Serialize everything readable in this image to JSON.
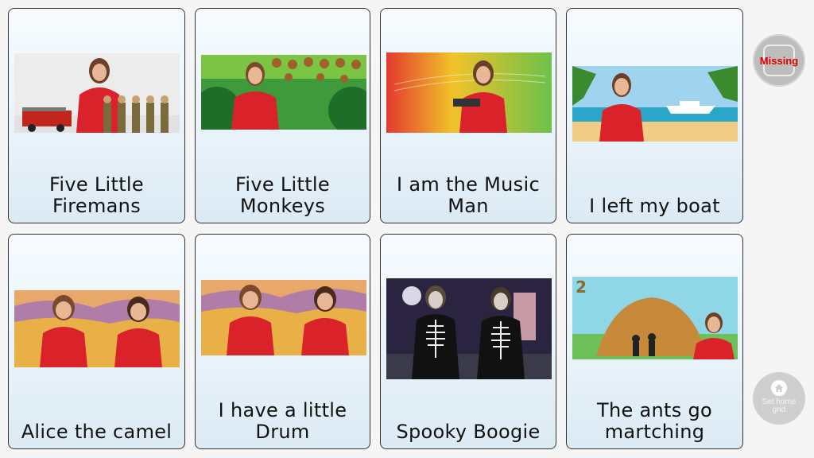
{
  "tiles": [
    {
      "label": "Five Little Firemans",
      "image": "fireman-video-thumbnail"
    },
    {
      "label": "Five Little Monkeys",
      "image": "monkeys-jungle-video-thumbnail"
    },
    {
      "label": "I am the Music Man",
      "image": "music-man-video-thumbnail"
    },
    {
      "label": "I left my boat",
      "image": "beach-boat-video-thumbnail"
    },
    {
      "label": "Alice the camel",
      "image": "desert-duo-video-thumbnail"
    },
    {
      "label": "I have a little Drum",
      "image": "desert-duo-video-thumbnail"
    },
    {
      "label": "Spooky Boogie",
      "image": "skeleton-costume-video-thumbnail"
    },
    {
      "label": "The ants go martching",
      "image": "anthill-video-thumbnail"
    }
  ],
  "sidebar": {
    "missing_label": "Missing",
    "home_label_line1": "Set home",
    "home_label_line2": "grid"
  },
  "colors": {
    "shirt": "#d9222a",
    "tile_border": "#333333",
    "missing_text": "#e00000"
  },
  "thumb_text": {
    "anthill_number": "2"
  }
}
